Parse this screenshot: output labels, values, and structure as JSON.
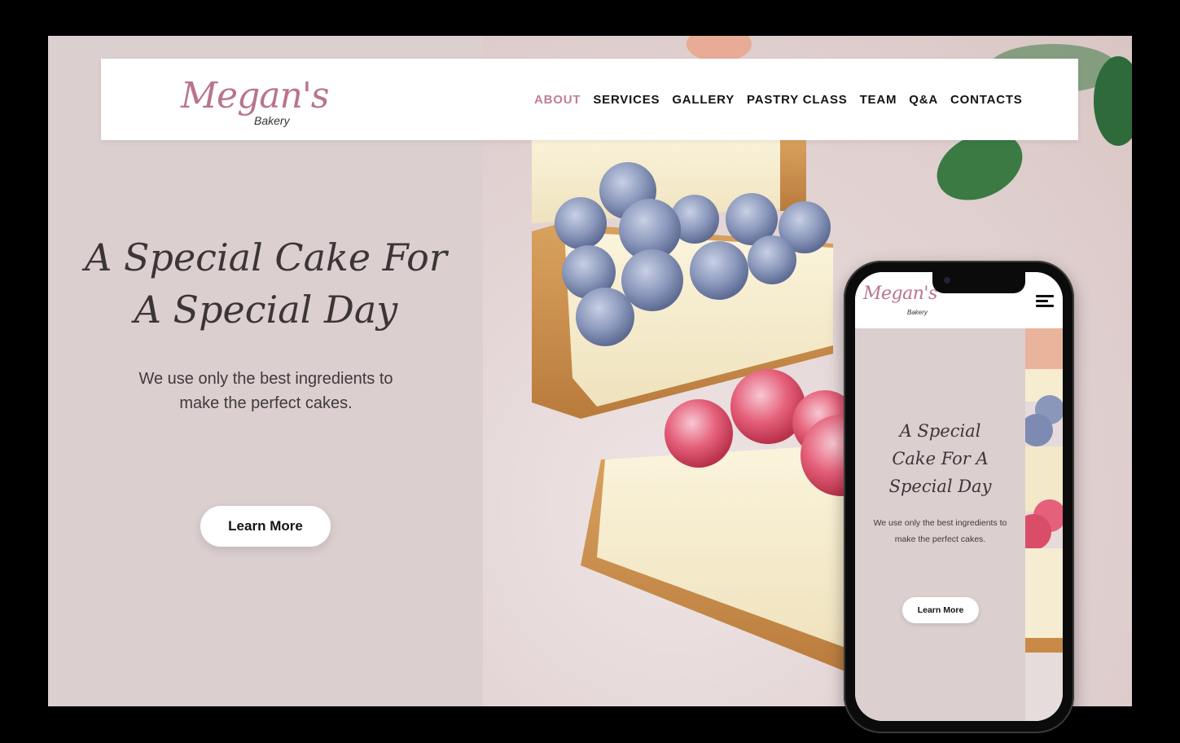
{
  "brand": {
    "name": "Megan's",
    "subtitle": "Bakery",
    "accent_color": "#c07f96",
    "panel_color": "#dccfd0"
  },
  "nav": {
    "items": [
      {
        "label": "ABOUT",
        "active": true
      },
      {
        "label": "SERVICES",
        "active": false
      },
      {
        "label": "GALLERY",
        "active": false
      },
      {
        "label": "PASTRY CLASS",
        "active": false
      },
      {
        "label": "TEAM",
        "active": false
      },
      {
        "label": "Q&A",
        "active": false
      },
      {
        "label": "CONTACTS",
        "active": false
      }
    ]
  },
  "hero": {
    "title_line1": "A Special Cake For",
    "title_line2": "A Special Day",
    "description_line1": "We use only the best ingredients to",
    "description_line2": "make the perfect cakes.",
    "cta_label": "Learn More",
    "image_alt": "Cheesecake slices topped with frozen blueberries and raspberries"
  },
  "mobile": {
    "brand_name": "Megan's",
    "brand_subtitle": "Bakery",
    "menu_icon": "hamburger-menu-icon",
    "title_line1": "A Special",
    "title_line2": "Cake For A",
    "title_line3": "Special Day",
    "description_line1": "We use only the best ingredients to",
    "description_line2": "make the perfect cakes.",
    "cta_label": "Learn More"
  }
}
